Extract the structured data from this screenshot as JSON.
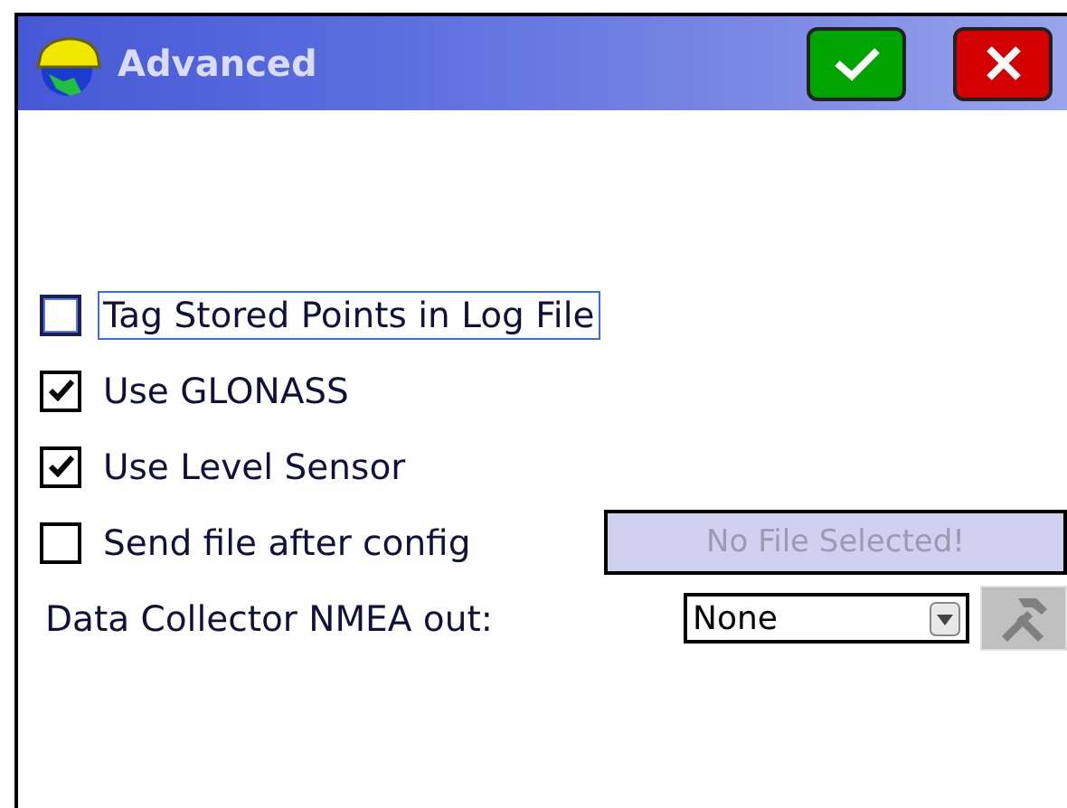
{
  "window": {
    "title": "Advanced"
  },
  "title_buttons": [
    {
      "kind": "ok"
    },
    {
      "kind": "cancel"
    }
  ],
  "options": [
    {
      "kind": "checkbox",
      "label": "Tag Stored Points in Log File",
      "checked": false,
      "focused": true
    },
    {
      "kind": "checkbox",
      "label": "Use GLONASS",
      "checked": true,
      "focused": false
    },
    {
      "kind": "checkbox",
      "label": "Use Level Sensor",
      "checked": true,
      "focused": false
    },
    {
      "kind": "checkbox_file",
      "label": "Send file after config",
      "checked": false,
      "focused": false,
      "file_button": {
        "label": "No File Selected!",
        "disabled": true
      }
    },
    {
      "kind": "dropdown",
      "label": "Data Collector NMEA out:",
      "value": "None",
      "tools_disabled": true
    }
  ]
}
